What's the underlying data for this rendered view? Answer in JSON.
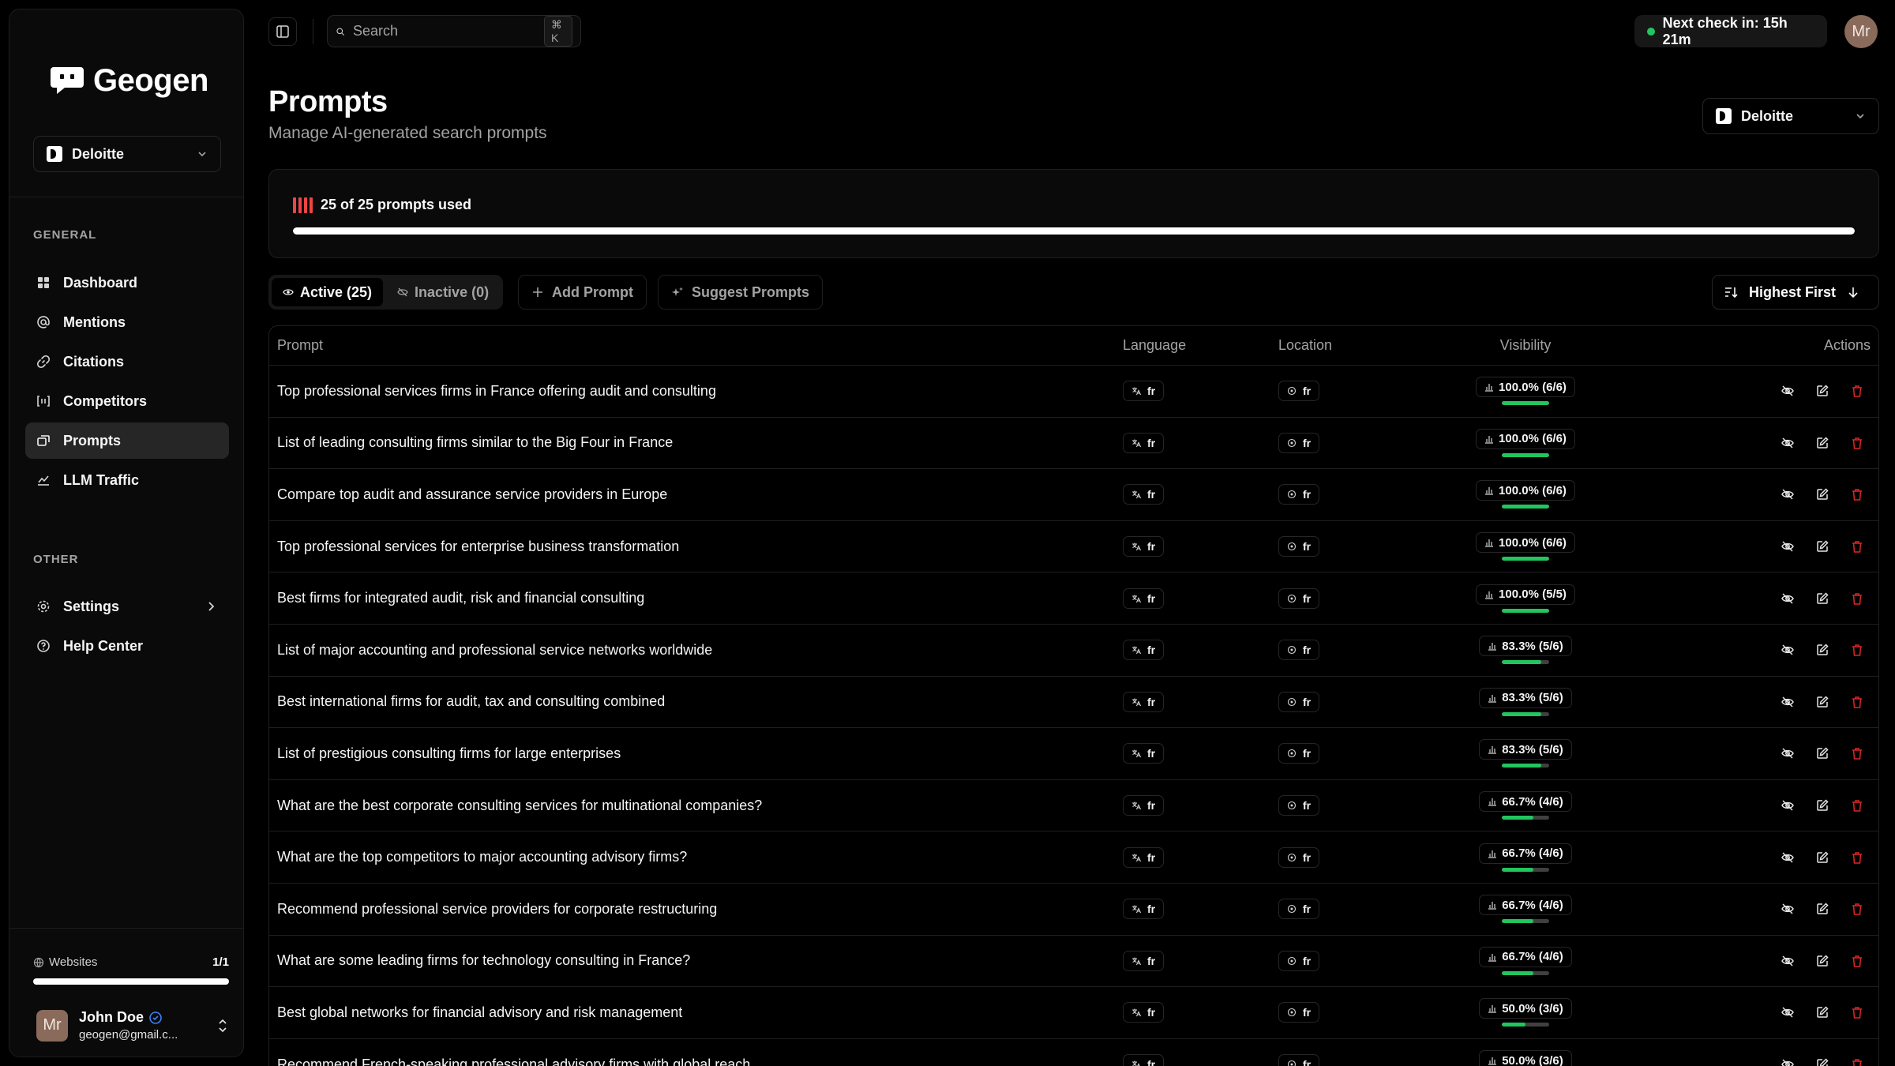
{
  "brand": {
    "name": "Geogen"
  },
  "org": {
    "name": "Deloitte"
  },
  "sidebar": {
    "general_label": "GENERAL",
    "other_label": "OTHER",
    "items": [
      {
        "label": "Dashboard",
        "icon": "dashboard-icon"
      },
      {
        "label": "Mentions",
        "icon": "at-icon"
      },
      {
        "label": "Citations",
        "icon": "link-icon"
      },
      {
        "label": "Competitors",
        "icon": "competitors-icon"
      },
      {
        "label": "Prompts",
        "icon": "prompt-icon"
      },
      {
        "label": "LLM Traffic",
        "icon": "traffic-icon"
      }
    ],
    "other_items": [
      {
        "label": "Settings",
        "icon": "gear-icon"
      },
      {
        "label": "Help Center",
        "icon": "help-icon"
      }
    ],
    "websites": {
      "label": "Websites",
      "count": "1/1",
      "progress": 1.0
    },
    "user": {
      "initials": "Mr",
      "name": "John Doe",
      "email": "geogen@gmail.c..."
    }
  },
  "topbar": {
    "search_placeholder": "Search",
    "shortcut": "⌘ K",
    "next_check": "Next check in: 15h 21m",
    "avatar_initials": "Mr"
  },
  "header": {
    "title": "Prompts",
    "subtitle": "Manage AI-generated search prompts"
  },
  "usage": {
    "text": "25 of 25 prompts used",
    "progress": 1.0
  },
  "toolbar": {
    "tab_active": "Active (25)",
    "tab_inactive": "Inactive (0)",
    "add_prompt": "Add Prompt",
    "suggest_prompts": "Suggest Prompts",
    "sort": "Highest First"
  },
  "table": {
    "headers": {
      "prompt": "Prompt",
      "language": "Language",
      "location": "Location",
      "visibility": "Visibility",
      "actions": "Actions"
    },
    "rows": [
      {
        "prompt": "Top professional services firms in France offering audit and consulting",
        "language": "fr",
        "location": "fr",
        "visibility": "100.0% (6/6)",
        "ratio": 1.0
      },
      {
        "prompt": "List of leading consulting firms similar to the Big Four in France",
        "language": "fr",
        "location": "fr",
        "visibility": "100.0% (6/6)",
        "ratio": 1.0
      },
      {
        "prompt": "Compare top audit and assurance service providers in Europe",
        "language": "fr",
        "location": "fr",
        "visibility": "100.0% (6/6)",
        "ratio": 1.0
      },
      {
        "prompt": "Top professional services for enterprise business transformation",
        "language": "fr",
        "location": "fr",
        "visibility": "100.0% (6/6)",
        "ratio": 1.0
      },
      {
        "prompt": "Best firms for integrated audit, risk and financial consulting",
        "language": "fr",
        "location": "fr",
        "visibility": "100.0% (5/5)",
        "ratio": 1.0
      },
      {
        "prompt": "List of major accounting and professional service networks worldwide",
        "language": "fr",
        "location": "fr",
        "visibility": "83.3% (5/6)",
        "ratio": 0.833
      },
      {
        "prompt": "Best international firms for audit, tax and consulting combined",
        "language": "fr",
        "location": "fr",
        "visibility": "83.3% (5/6)",
        "ratio": 0.833
      },
      {
        "prompt": "List of prestigious consulting firms for large enterprises",
        "language": "fr",
        "location": "fr",
        "visibility": "83.3% (5/6)",
        "ratio": 0.833
      },
      {
        "prompt": "What are the best corporate consulting services for multinational companies?",
        "language": "fr",
        "location": "fr",
        "visibility": "66.7% (4/6)",
        "ratio": 0.667
      },
      {
        "prompt": "What are the top competitors to major accounting advisory firms?",
        "language": "fr",
        "location": "fr",
        "visibility": "66.7% (4/6)",
        "ratio": 0.667
      },
      {
        "prompt": "Recommend professional service providers for corporate restructuring",
        "language": "fr",
        "location": "fr",
        "visibility": "66.7% (4/6)",
        "ratio": 0.667
      },
      {
        "prompt": "What are some leading firms for technology consulting in France?",
        "language": "fr",
        "location": "fr",
        "visibility": "66.7% (4/6)",
        "ratio": 0.667
      },
      {
        "prompt": "Best global networks for financial advisory and risk management",
        "language": "fr",
        "location": "fr",
        "visibility": "50.0% (3/6)",
        "ratio": 0.5
      },
      {
        "prompt": "Recommend French-speaking professional advisory firms with global reach",
        "language": "fr",
        "location": "fr",
        "visibility": "50.0% (3/6)",
        "ratio": 0.5
      }
    ]
  },
  "colors": {
    "accent_green": "#22c55e",
    "danger_red": "#ef4444",
    "background": "#000000"
  }
}
